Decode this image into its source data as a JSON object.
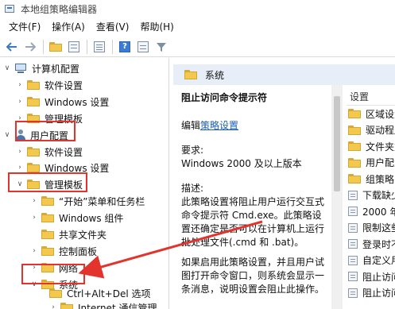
{
  "window": {
    "title": "本地组策略编辑器"
  },
  "menu": [
    "文件(F)",
    "操作(A)",
    "查看(V)",
    "帮助(H)"
  ],
  "toolbar": {
    "icons": [
      "back-arrow-icon",
      "forward-arrow-icon",
      "up-folder-icon",
      "show-hide-tree-icon",
      "export-list-icon",
      "help-icon",
      "properties-icon",
      "filter-icon"
    ]
  },
  "tree": {
    "computer_config": "计算机配置",
    "cc_software": "软件设置",
    "cc_windows": "Windows 设置",
    "cc_admin": "管理模板",
    "user_config": "用户配置",
    "uc_software": "软件设置",
    "uc_windows": "Windows 设置",
    "uc_admin": "管理模板",
    "start_menu": "“开始”菜单和任务栏",
    "win_components": "Windows 组件",
    "shared_folders": "共享文件夹",
    "control_panel": "控制面板",
    "network": "网络",
    "system": "系统",
    "cad_options": "Ctrl+Alt+Del 选项",
    "internet_mgmt": "Internet 通信管理"
  },
  "details": {
    "header": "系统",
    "policy_title": "阻止访问命令提示符",
    "edit_prefix": "编辑",
    "edit_link": "策略设置",
    "req_label": "要求:",
    "req_value": "Windows 2000 及以上版本",
    "desc_label": "描述:",
    "desc_text": "此策略设置将阻止用户运行交互式命令提示符 Cmd.exe。此策略设置还确定是否可以在计算机上运行批处理文件(.cmd 和 .bat)。",
    "desc_text2": "如果启用此策略设置，并且用户试图打开命令窗口，则系统会显示一条消息，说明设置会阻止此操作。"
  },
  "list": {
    "header": "设置",
    "items": [
      {
        "label": "区域设置",
        "icon": "folder-icon"
      },
      {
        "label": "驱动程序",
        "icon": "folder-icon"
      },
      {
        "label": "文件夹重",
        "icon": "folder-icon"
      },
      {
        "label": "用户配置",
        "icon": "folder-icon"
      },
      {
        "label": "组策略",
        "icon": "folder-icon"
      },
      {
        "label": "下载缺少",
        "icon": "setting-icon"
      },
      {
        "label": "2000 年",
        "icon": "setting-icon"
      },
      {
        "label": "限制这些",
        "icon": "setting-icon"
      },
      {
        "label": "登录时不",
        "icon": "setting-icon"
      },
      {
        "label": "自定义用",
        "icon": "setting-icon"
      },
      {
        "label": "阻止访问",
        "icon": "setting-icon"
      },
      {
        "label": "阻止访问",
        "icon": "setting-icon"
      }
    ]
  },
  "colors": {
    "highlight_box": "#e2342d",
    "header_bg": "#e8eef7",
    "link": "#1a5fb4"
  }
}
